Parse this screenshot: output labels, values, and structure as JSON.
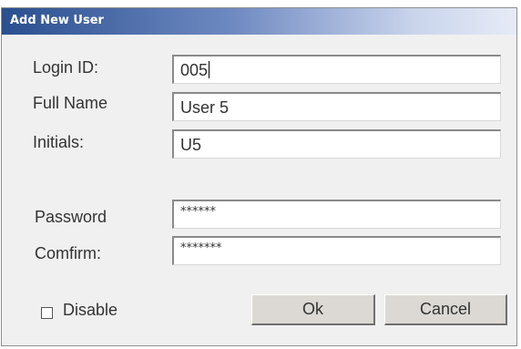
{
  "dialog": {
    "title": "Add New User"
  },
  "form": {
    "login_id": {
      "label": "Login ID:",
      "value": "005"
    },
    "full_name": {
      "label": "Full Name",
      "value": "User 5"
    },
    "initials": {
      "label": "Initials:",
      "value": "U5"
    },
    "password": {
      "label": "Password",
      "value": "******"
    },
    "confirm": {
      "label": "Comfirm:",
      "value": "*******"
    }
  },
  "disable": {
    "label": "Disable",
    "checked": false
  },
  "buttons": {
    "ok": "Ok",
    "cancel": "Cancel"
  }
}
